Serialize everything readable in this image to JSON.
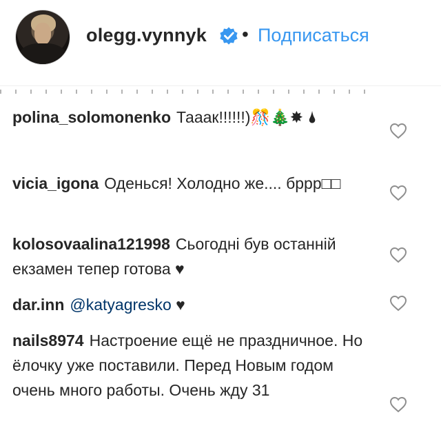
{
  "header": {
    "username": "olegg.vynnyk",
    "separator": "•",
    "follow_label": "Подписаться"
  },
  "comments": [
    {
      "user": "polina_solomonenko",
      "text": "Тааак!!!!!!)🎊🎄✸ 🌢"
    },
    {
      "user": "vicia_igona",
      "text": "Оденься! Холодно же.... бррр□□"
    },
    {
      "user": "kolosovaalina121998",
      "text": "Сьогодні був останній екзамен тепер готова ♥"
    },
    {
      "user": "dar.inn",
      "mention": "@katyagresko",
      "text": "♥"
    },
    {
      "user": "nails8974",
      "text": "Настроение ещё не праздничное. Но ёлочку уже поставили. Перед Новым годом очень много работы. Очень жду 31"
    }
  ],
  "icons": {
    "verified": "verified-badge-icon",
    "like": "heart-outline-icon"
  },
  "colors": {
    "link": "#3897f0",
    "text": "#262626",
    "verified": "#3897f0"
  }
}
